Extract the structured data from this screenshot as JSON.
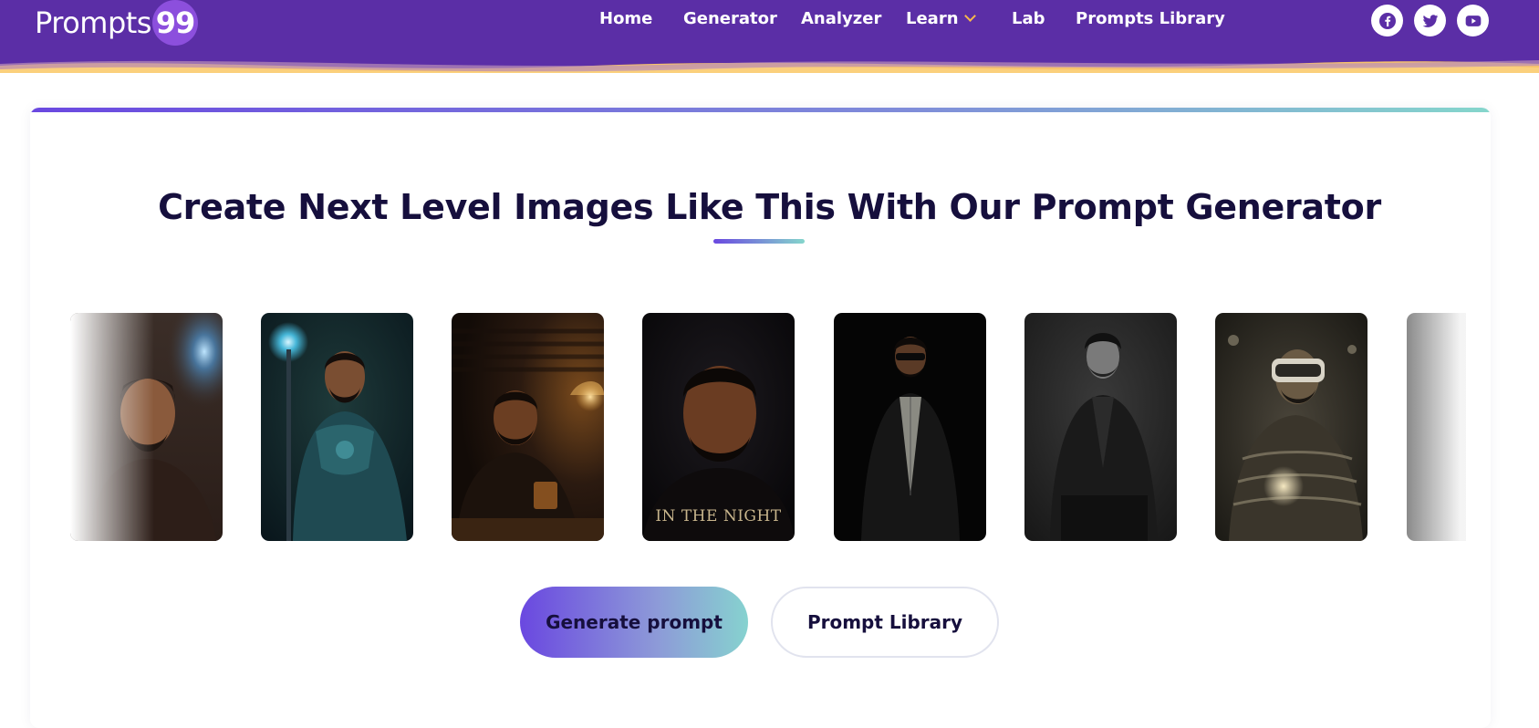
{
  "header": {
    "logo_text": "Prompts",
    "logo_badge": "99",
    "nav": [
      {
        "label": "Home"
      },
      {
        "label": "Generator"
      },
      {
        "label": "Analyzer"
      },
      {
        "label": "Learn",
        "icon": "chevron-down-icon"
      },
      {
        "label": "Lab"
      },
      {
        "label": "Prompts Library"
      }
    ],
    "social": [
      {
        "icon": "facebook-icon"
      },
      {
        "icon": "twitter-icon"
      },
      {
        "icon": "youtube-icon"
      }
    ]
  },
  "main": {
    "heading": "Create Next Level Images Like This With Our Prompt Generator",
    "gallery": [
      {
        "name": "portrait-blue-light"
      },
      {
        "name": "portrait-armored-wizard"
      },
      {
        "name": "portrait-lamp-whiskey"
      },
      {
        "name": "portrait-in-the-night",
        "caption": "IN THE NIGHT"
      },
      {
        "name": "portrait-sunglasses-suit"
      },
      {
        "name": "portrait-bw-suit-seated"
      },
      {
        "name": "portrait-vr-headset"
      },
      {
        "name": "portrait-partial"
      }
    ],
    "buttons": {
      "generate": "Generate prompt",
      "library": "Prompt Library"
    }
  },
  "colors": {
    "header_bg": "#5b2ea6",
    "accent_start": "#6a48e0",
    "accent_end": "#85d6cc",
    "heading": "#160f3d",
    "wave_orange": "#f7c26b"
  }
}
